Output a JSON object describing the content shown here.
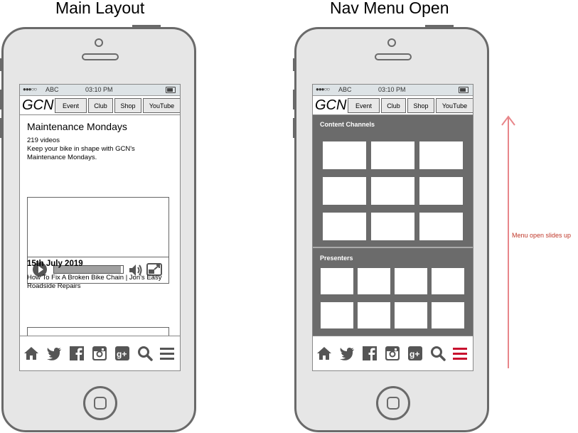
{
  "titles": {
    "left": "Main Layout",
    "right": "Nav Menu Open"
  },
  "statusbar": {
    "signal": "●●●○○",
    "carrier": "ABC",
    "time": "03:10 PM"
  },
  "header": {
    "logo": "GCN",
    "nav": [
      "Event",
      "Club",
      "Shop",
      "YouTube"
    ]
  },
  "main": {
    "title": "Maintenance Mondays",
    "count": "219 videos",
    "description_line1": "Keep your bike in shape with GCN's",
    "description_line2": "Maintenance Mondays.",
    "video_progress": 0.97,
    "date": "15th July 2019",
    "video_title_line1": "How To Fix A Broken Bike Chain | Jon's Easy",
    "video_title_line2": "Roadside Repairs"
  },
  "menu": {
    "section1": "Content Channels",
    "section2": "Presenters"
  },
  "bottom_icons": [
    "home-icon",
    "twitter-icon",
    "facebook-icon",
    "instagram-icon",
    "google-plus-icon",
    "search-icon",
    "menu-icon"
  ],
  "annotation": {
    "text": "Menu open slides up",
    "color": "#c0392b"
  },
  "colors": {
    "menu_bg": "#6b6b6b",
    "active_menu_icon": "#c8102e",
    "icon_gray": "#555555"
  }
}
